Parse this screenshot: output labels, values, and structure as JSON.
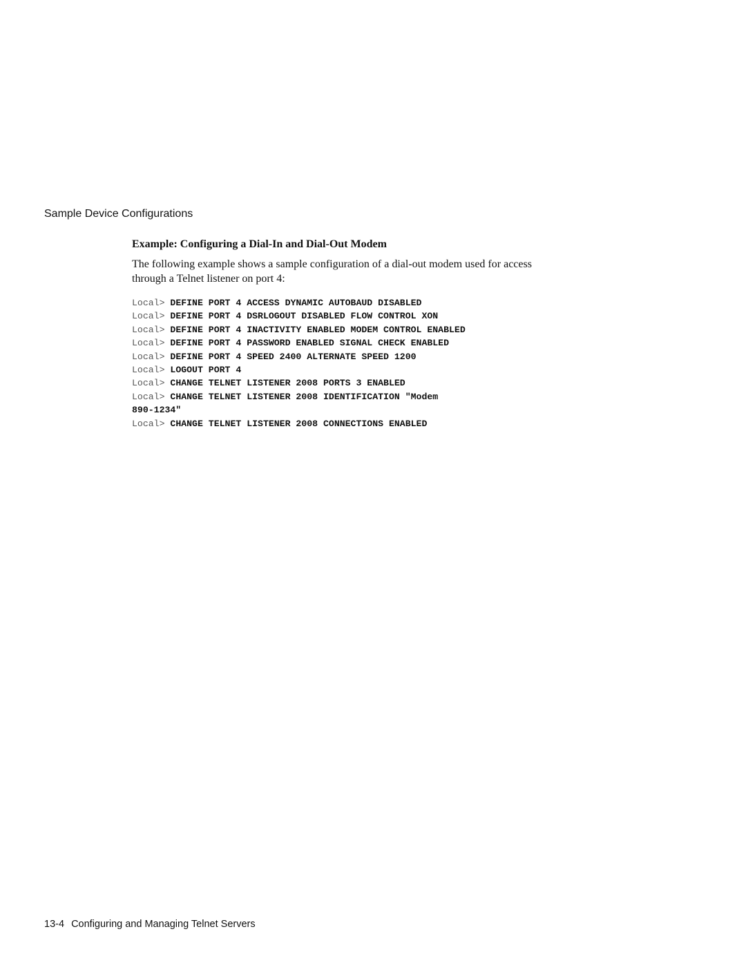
{
  "running_header": "Sample Device Configurations",
  "section": {
    "title": "Example: Configuring a Dial-In and Dial-Out Modem",
    "intro": "The following example shows a sample configuration of a dial-out modem used for access through a Telnet listener on port 4:"
  },
  "code": {
    "lines": [
      {
        "prompt": "Local> ",
        "command": "DEFINE PORT 4 ACCESS DYNAMIC AUTOBAUD DISABLED"
      },
      {
        "prompt": "Local> ",
        "command": "DEFINE PORT 4 DSRLOGOUT DISABLED FLOW CONTROL XON"
      },
      {
        "prompt": "Local> ",
        "command": "DEFINE PORT 4 INACTIVITY ENABLED MODEM CONTROL ENABLED"
      },
      {
        "prompt": "Local> ",
        "command": "DEFINE PORT 4 PASSWORD ENABLED SIGNAL CHECK ENABLED"
      },
      {
        "prompt": "Local> ",
        "command": "DEFINE PORT 4 SPEED 2400 ALTERNATE SPEED 1200"
      },
      {
        "prompt": "Local> ",
        "command": "LOGOUT PORT 4"
      },
      {
        "prompt": "Local> ",
        "command": "CHANGE TELNET LISTENER 2008 PORTS 3 ENABLED"
      },
      {
        "prompt": "Local> ",
        "command": "CHANGE TELNET LISTENER 2008 IDENTIFICATION \"Modem"
      },
      {
        "prompt": "",
        "command": "890-1234\""
      },
      {
        "prompt": "Local> ",
        "command": "CHANGE TELNET LISTENER 2008 CONNECTIONS ENABLED"
      }
    ]
  },
  "footer": {
    "page_number": "13-4",
    "title": "Configuring and Managing Telnet Servers"
  }
}
